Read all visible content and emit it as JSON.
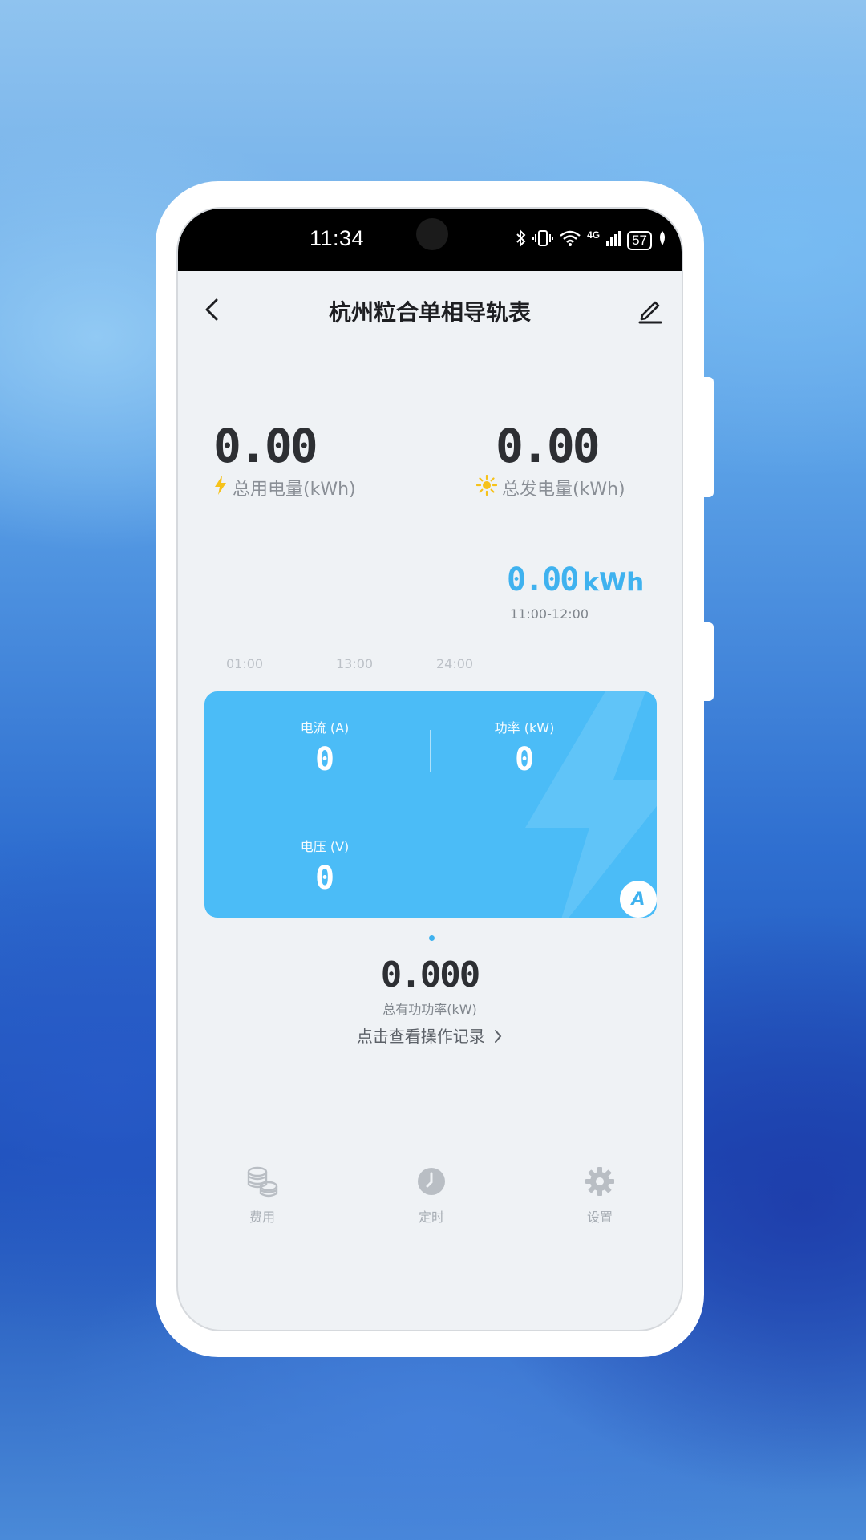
{
  "status_bar": {
    "time": "11:34",
    "network": "4G",
    "battery": "57"
  },
  "header": {
    "title": "杭州粒合单相导轨表"
  },
  "stats": {
    "consumption": {
      "value": "0.00",
      "label": "总用电量(kWh)"
    },
    "generation": {
      "value": "0.00",
      "label": "总发电量(kWh)"
    }
  },
  "chart": {
    "selected_value": "0.00",
    "unit": "kWh",
    "selected_range": "11:00-12:00",
    "x_ticks": [
      "01:00",
      "13:00",
      "24:00"
    ]
  },
  "card": {
    "current": {
      "label": "电流 (A)",
      "value": "0"
    },
    "power": {
      "label": "功率 (kW)",
      "value": "0"
    },
    "voltage": {
      "label": "电压 (V)",
      "value": "0"
    },
    "mode": "A"
  },
  "total_power": {
    "value": "0.000",
    "label": "总有功功率(kW)"
  },
  "operation_log": {
    "label": "点击查看操作记录"
  },
  "tabs": [
    {
      "label": "费用",
      "icon": "coins-icon"
    },
    {
      "label": "定时",
      "icon": "clock-icon"
    },
    {
      "label": "设置",
      "icon": "gear-icon"
    }
  ],
  "colors": {
    "accent": "#3fb2ef",
    "card": "#4bbcf7",
    "screen_bg": "#eff2f5"
  }
}
